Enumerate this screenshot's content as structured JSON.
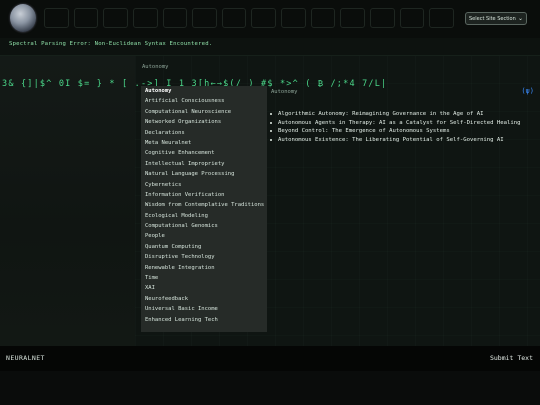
{
  "header": {
    "select_label": "Select Site Section",
    "chevron": "⌄"
  },
  "error_message": "Spectral Parsing Error: Non-Euclidean Syntax Encountered.",
  "glitch_text": "3&        {]|$^ 0I   $=   }  *    [ .->]   I  1  3[h←→$(/      ) #$       *>^ (      ₿  /;*4 7/L|",
  "glitch_suffix": "(ψ)",
  "breadcrumb": "Autonomy",
  "topics": [
    {
      "label": "Autonomy",
      "active": true
    },
    {
      "label": "Artificial Consciousness"
    },
    {
      "label": "Computational Neuroscience"
    },
    {
      "label": "Networked Organizations"
    },
    {
      "label": "Declarations"
    },
    {
      "label": "Meta Neuralnet"
    },
    {
      "label": "Cognitive Enhancement"
    },
    {
      "label": "Intellectual Impropriety"
    },
    {
      "label": "Natural Language Processing"
    },
    {
      "label": "Cybernetics"
    },
    {
      "label": "Information Verification"
    },
    {
      "label": "Wisdom from Contemplative Traditions"
    },
    {
      "label": "Ecological Modeling"
    },
    {
      "label": "Computational Genomics"
    },
    {
      "label": "People"
    },
    {
      "label": "Quantum Computing"
    },
    {
      "label": "Disruptive Technology"
    },
    {
      "label": "Renewable Integration"
    },
    {
      "label": "Time"
    },
    {
      "label": "XAI"
    },
    {
      "label": "Neurofeedback"
    },
    {
      "label": "Universal Basic Income"
    },
    {
      "label": "Enhanced Learning Tech"
    }
  ],
  "content": {
    "title": "Autonomy",
    "articles": [
      "Algorithmic Autonomy: Reimagining Governance in the Age of AI",
      "Autonomous Agents in Therapy: AI as a Catalyst for Self-Directed Healing",
      "Beyond Control: The Emergence of Autonomous Systems",
      "Autonomous Existence: The Liberating Potential of Self-Governing AI"
    ]
  },
  "footer": {
    "brand": "NEURALNET",
    "submit_label": "Submit Text"
  }
}
